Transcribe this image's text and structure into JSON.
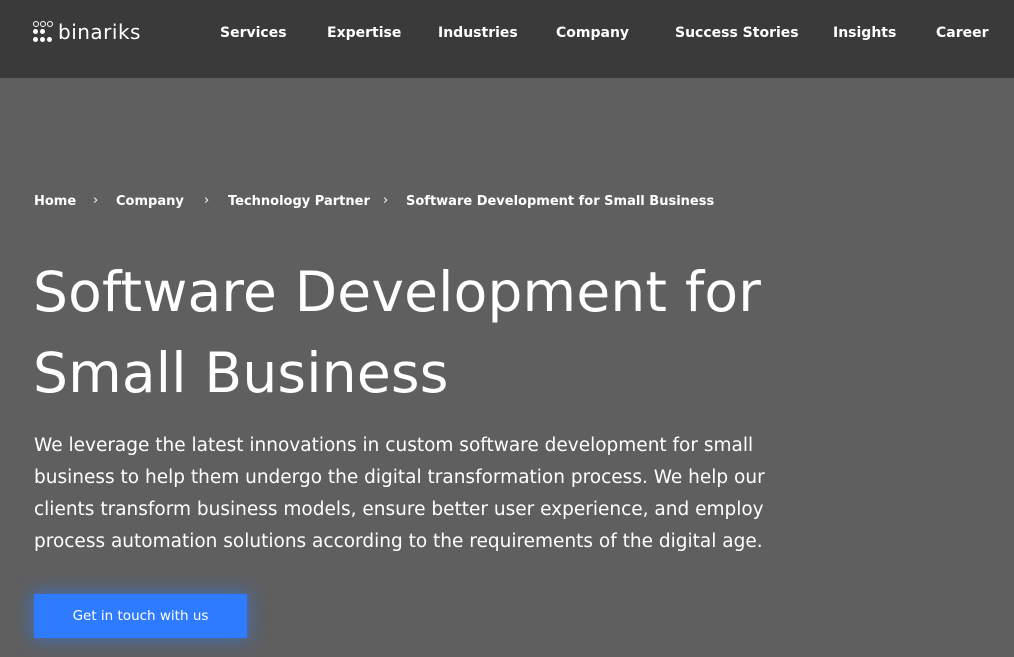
{
  "brand": {
    "logo_text": "binariks",
    "logo_icon": "dot-grid-logo-icon"
  },
  "nav": {
    "items": [
      {
        "label": "Services"
      },
      {
        "label": "Expertise"
      },
      {
        "label": "Industries"
      },
      {
        "label": "Company"
      },
      {
        "label": "Success Stories"
      },
      {
        "label": "Insights"
      },
      {
        "label": "Career"
      }
    ]
  },
  "breadcrumb": {
    "separator": "›",
    "items": [
      {
        "label": "Home"
      },
      {
        "label": "Company"
      },
      {
        "label": "Technology Partner"
      },
      {
        "label": "Software Development for Small Business"
      }
    ]
  },
  "hero": {
    "title_lines": [
      "Software Development for",
      "Small Business"
    ],
    "intro_lines": [
      "We leverage the latest innovations in custom software development for small",
      "business to help them undergo the digital transformation process. We help our",
      "clients transform business models, ensure better user experience, and employ",
      "process automation solutions according to the requirements of the digital age."
    ],
    "cta_label": "Get in touch with us"
  },
  "colors": {
    "navbar_bg": "#3a3a3a",
    "page_bg": "#5f5f5f",
    "text": "#ffffff",
    "cta_bg": "#2f7bff"
  }
}
